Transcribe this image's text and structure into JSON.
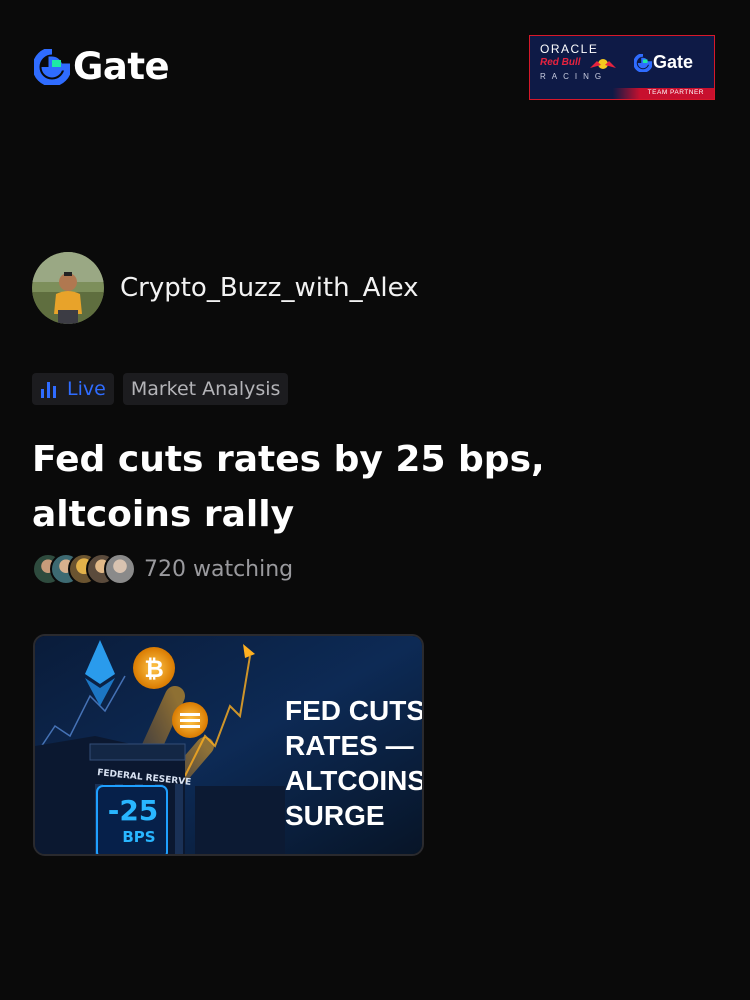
{
  "brand": {
    "name": "Gate",
    "accent": "#2f6cff"
  },
  "partner": {
    "oracle": "ORACLE",
    "redbull": "Red Bull",
    "racing": "RACING",
    "gate": "Gate",
    "badge": "TEAM PARTNER"
  },
  "author": {
    "name": "Crypto_Buzz_with_Alex",
    "avatar_icon": "avatar-photo"
  },
  "tags": {
    "live": "Live",
    "category": "Market Analysis"
  },
  "post": {
    "title": "Fed cuts rates by 25 bps, altcoins rally"
  },
  "watchers": {
    "count_text": "720 watching"
  },
  "thumbnail": {
    "building_label": "FEDERAL RESERVE",
    "rate_value": "-25",
    "rate_unit": "BPS",
    "headline_lines": [
      "FED CUTS",
      "RATES —",
      "ALTCOINS",
      "SURGE"
    ]
  }
}
